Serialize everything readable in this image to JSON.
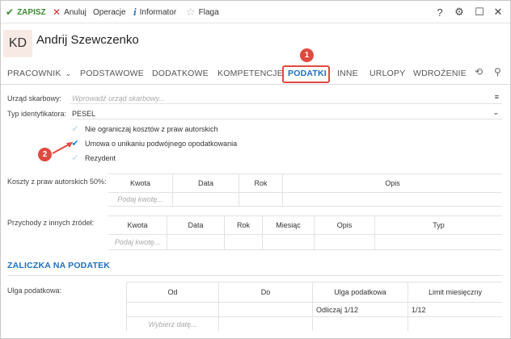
{
  "toolbar": {
    "save_label": "ZAPISZ",
    "cancel_label": "Anuluj",
    "operations_label": "Operacje",
    "informator_label": "Informator",
    "flag_label": "Flaga"
  },
  "window_controls": [
    "?",
    "⚙",
    "☐",
    "✕"
  ],
  "header": {
    "initials": "KD",
    "employee_name": "Andrij Szewczenko"
  },
  "tabs": [
    {
      "label": "PRACOWNIK",
      "active": false,
      "has_dropdown": true
    },
    {
      "label": "PODSTAWOWE",
      "active": false
    },
    {
      "label": "DODATKOWE",
      "active": false
    },
    {
      "label": "KOMPETENCJE",
      "active": false
    },
    {
      "label": "PODATKI",
      "active": true
    },
    {
      "label": "INNE",
      "active": false
    },
    {
      "label": "URLOPY",
      "active": false
    },
    {
      "label": "WDROŻENIE",
      "active": false
    }
  ],
  "tab_icons": [
    "history-icon",
    "paperclip-icon"
  ],
  "callouts": {
    "first": "1",
    "second": "2"
  },
  "form": {
    "tax_office_label": "Urząd skarbowy:",
    "tax_office_placeholder": "Wprowadź urząd skarbowy...",
    "id_type_label": "Typ identyfikatora:",
    "id_type_value": "PESEL",
    "checkboxes": [
      {
        "label": "Nie ograniczaj kosztów z praw autorskich",
        "checked": false
      },
      {
        "label": "Umowa o unikaniu podwójnego opodatkowania",
        "checked": true
      },
      {
        "label": "Rezydent",
        "checked": false
      }
    ]
  },
  "author_costs": {
    "label": "Koszty z praw autorskich 50%:",
    "columns": [
      "Kwota",
      "Data",
      "Rok",
      "Opis"
    ],
    "placeholder": "Podaj kwotę..."
  },
  "other_income": {
    "label": "Przychody z innych źródeł:",
    "columns": [
      "Kwota",
      "Data",
      "Rok",
      "Miesiąc",
      "Opis",
      "Typ"
    ],
    "placeholder": "Podaj kwotę..."
  },
  "tax_advance": {
    "section_title": "ZALICZKA NA PODATEK",
    "relief_label": "Ulga podatkowa:",
    "columns": [
      "Od",
      "Do",
      "Ulga podatkowa",
      "Limit miesięczny"
    ],
    "row": {
      "relief": "Odliczaj 1/12",
      "limit": "1/12"
    },
    "date_placeholder": "Wybierz datę..."
  },
  "colors": {
    "accent": "#1e6fc0",
    "save": "#3a8a2e",
    "cancel": "#d32f2f",
    "callout": "#e04a3f"
  }
}
